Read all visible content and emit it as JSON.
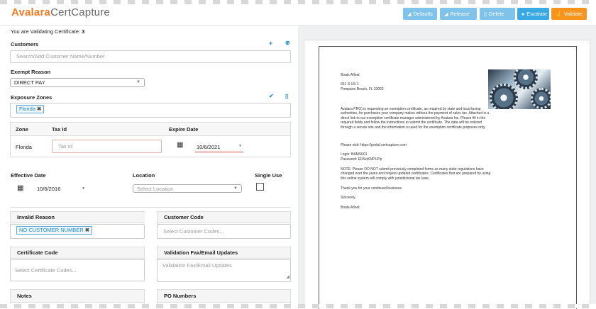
{
  "app": {
    "brand_part1": "Avalara",
    "brand_part2": "CertCapture"
  },
  "toolbar": {
    "defaults": "Defaults",
    "release": "Release",
    "delete": "Delete",
    "escalate": "Escalate",
    "validate": "Validate"
  },
  "validating": {
    "label": "You are Validating Certificate:",
    "number": "3"
  },
  "customers": {
    "label": "Customers",
    "placeholder": "Search/Add Customer Name/Number"
  },
  "exempt_reason": {
    "label": "Exempt Reason",
    "value": "DIRECT PAY"
  },
  "exposure_zones": {
    "label": "Exposure Zones",
    "tags": [
      "Florida"
    ],
    "table": {
      "headers": [
        "Zone",
        "Tax Id",
        "Expire Date"
      ],
      "rows": [
        {
          "zone": "Florida",
          "tax_id_placeholder": "Tax Id",
          "expire_date": "10/6/2021"
        }
      ]
    }
  },
  "effective_date": {
    "label": "Effective Date",
    "value": "10/6/2016"
  },
  "location": {
    "label": "Location",
    "placeholder": "Select Location"
  },
  "single_use": {
    "label": "Single Use",
    "checked": false
  },
  "invalid_reason": {
    "label": "Invalid Reason",
    "tags": [
      "NO CUSTOMER NUMBER"
    ]
  },
  "customer_code": {
    "label": "Customer Code",
    "placeholder": "Select Customer Codes..."
  },
  "certificate_code": {
    "label": "Certificate Code",
    "placeholder": "Select Certificate Codes..."
  },
  "validation_fax": {
    "label": "Validation Fax/Email Updates",
    "placeholder": "Validation Fax/Email Updates"
  },
  "notes": {
    "label": "Notes"
  },
  "po_numbers": {
    "label": "PO Numbers"
  },
  "letter": {
    "address": [
      "Boats Afloat",
      "651 S US 1",
      "Pompano Beach, FL 33062"
    ],
    "body": "Avalara PRO) is requesting an exemption certificate, as required by state and local taxing authorities, for purchases your company makes without the payment of sales tax. Attached is a direct link to our exemption certificate manager administered by Avalara Inc. Please fill in the required fields and follow the instructions to submit the certificate. The data will be entered through a secure site and the information is used for the exemption certificate purposes only.",
    "visit": "Please visit: https://portal.certcapture.com",
    "login": "Login: BAMS001",
    "password": "Password: ERSoKMPUPp",
    "note": "NOTE: Please DO NOT submit previously completed forms as many state regulations have changed over the years and require updated certificates. Certificates that are prepared by using this online system will comply with jurisdictional tax laws.",
    "thanks": "Thank you for your continued business.",
    "sincerely": "Sincerely,",
    "sign": "Boats Afloat"
  },
  "colors": {
    "accent_blue": "#38a9e3",
    "validate_orange": "#f7941d",
    "brand_orange": "#f47a20"
  }
}
